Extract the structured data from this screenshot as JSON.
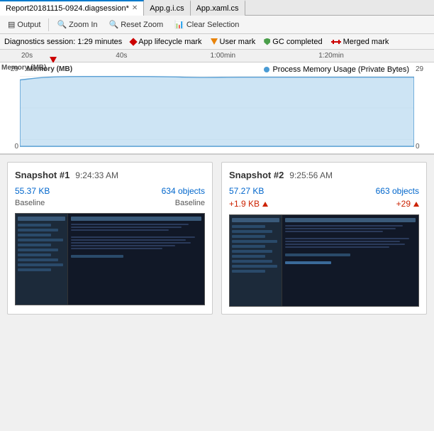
{
  "tabs": [
    {
      "label": "Report20181115-0924.diagsession*",
      "active": true,
      "closeable": true
    },
    {
      "label": "App.g.i.cs",
      "active": false,
      "closeable": false
    },
    {
      "label": "App.xaml.cs",
      "active": false,
      "closeable": false
    }
  ],
  "toolbar": {
    "output_label": "Output",
    "zoom_in_label": "Zoom In",
    "reset_zoom_label": "Reset Zoom",
    "clear_selection_label": "Clear Selection"
  },
  "info_bar": {
    "session_label": "Diagnostics session:",
    "duration": "1:29 minutes",
    "lifecycle_label": "App lifecycle mark",
    "user_mark_label": "User mark",
    "gc_label": "GC completed",
    "merged_label": "Merged mark"
  },
  "timeline": {
    "marks": [
      "20s",
      "40s",
      "1:00min",
      "1:20min"
    ]
  },
  "chart": {
    "title": "Memory (MB)",
    "legend": "Process Memory Usage (Private Bytes)",
    "y_top": "29",
    "y_bottom": "0",
    "y_top_right": "29",
    "y_bottom_right": "0"
  },
  "snapshots": [
    {
      "label": "Snapshot #1",
      "number": "1",
      "time": "9:24:33 AM",
      "kb": "55.37 KB",
      "objects": "634 objects",
      "baseline_left": "Baseline",
      "baseline_right": "Baseline",
      "delta_kb": null,
      "delta_objects": null
    },
    {
      "label": "Snapshot #2",
      "number": "2",
      "time": "9:25:56 AM",
      "kb": "57.27 KB",
      "objects": "663 objects",
      "delta_kb": "+1.9 KB",
      "delta_objects": "+29"
    }
  ]
}
